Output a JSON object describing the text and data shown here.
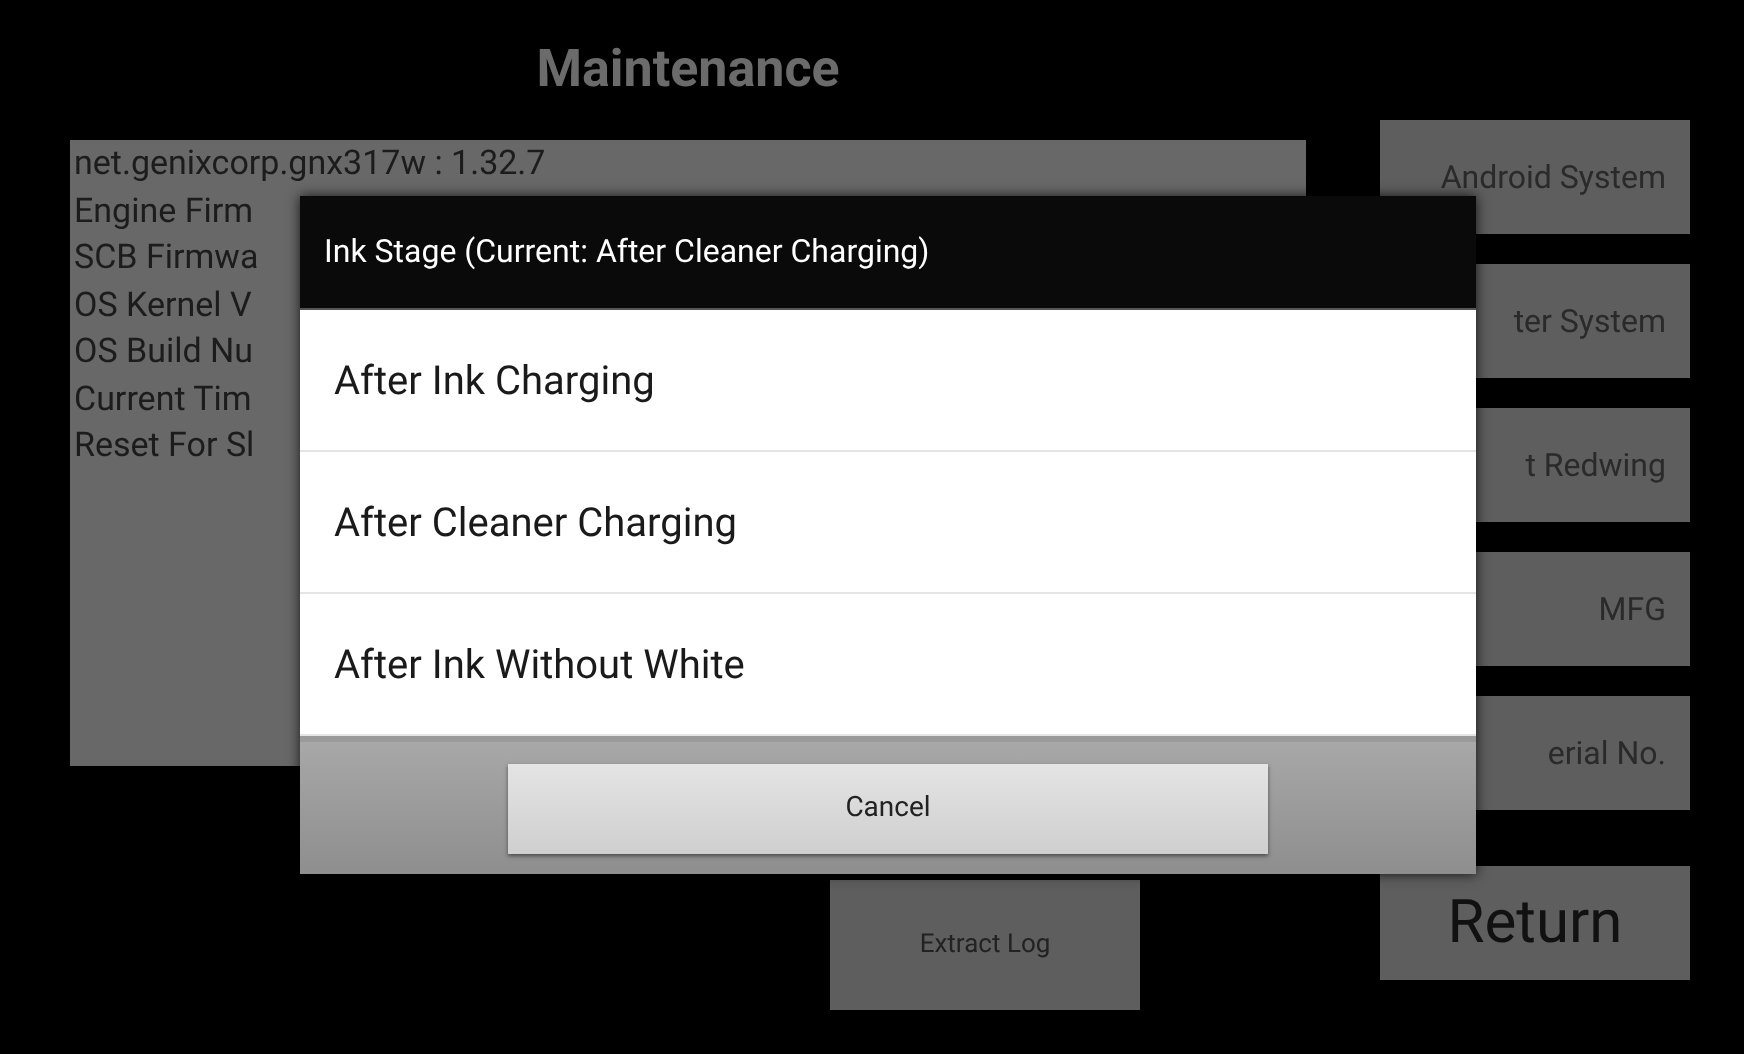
{
  "title": "Maintenance",
  "info_lines": [
    "net.genixcorp.gnx317w : 1.32.7",
    "Engine Firm",
    "SCB Firmwa",
    "OS Kernel V",
    "OS Build Nu",
    "Current Tim",
    "Reset For Sl"
  ],
  "side_buttons": [
    {
      "label": "Android System"
    },
    {
      "label": "ter System"
    },
    {
      "label": "t Redwing"
    },
    {
      "label": "MFG"
    },
    {
      "label": "erial No."
    }
  ],
  "extract_log": "Extract Log",
  "return": "Return",
  "dialog": {
    "title": "Ink Stage (Current: After Cleaner Charging)",
    "options": [
      {
        "label": "After Ink Charging"
      },
      {
        "label": "After Cleaner Charging"
      },
      {
        "label": "After Ink Without White"
      }
    ],
    "cancel": "Cancel"
  }
}
